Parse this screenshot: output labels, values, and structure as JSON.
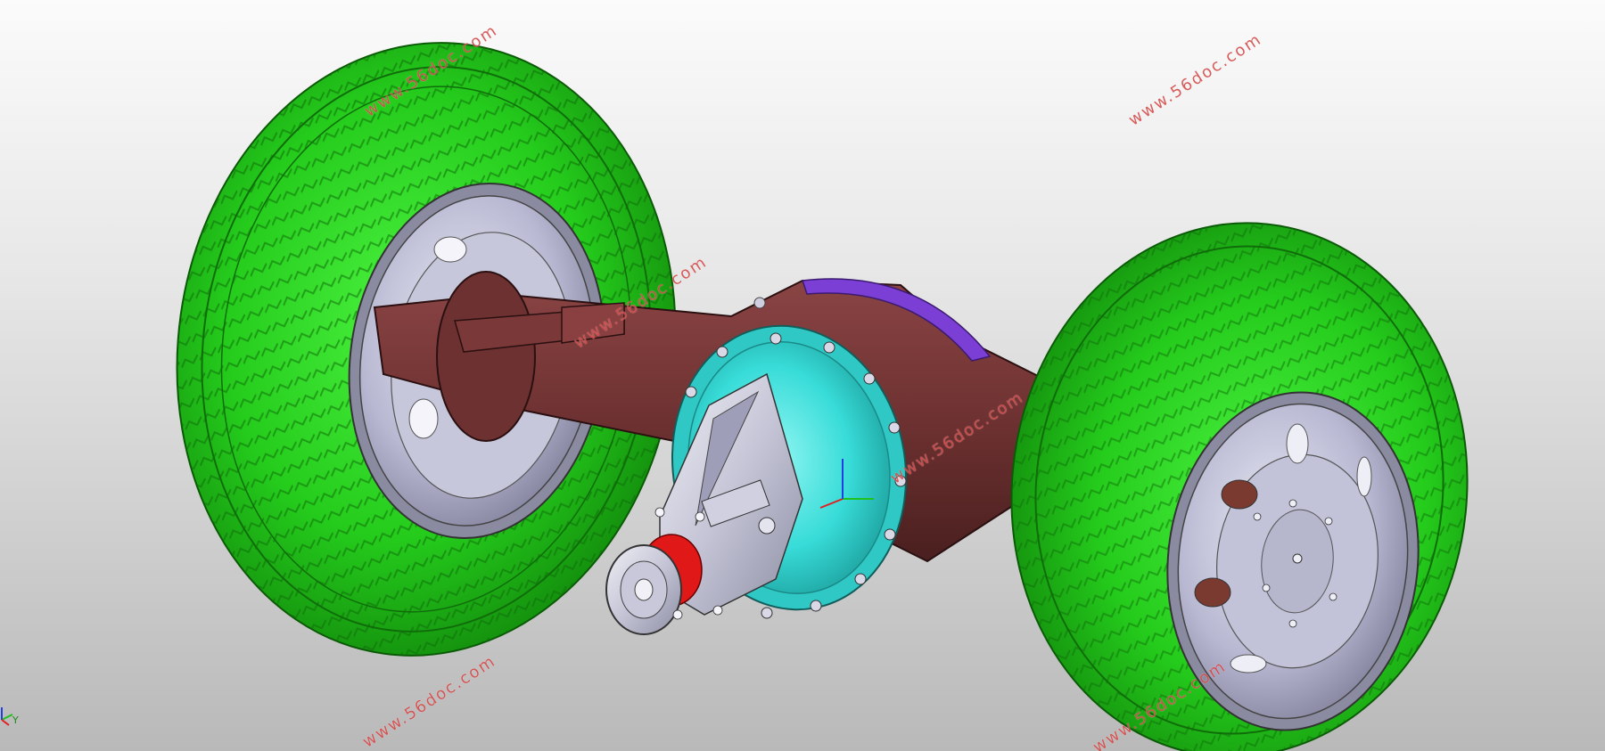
{
  "viewport": {
    "background_top": "#fbfbfb",
    "background_bottom": "#b9b9b9"
  },
  "model": {
    "tire_color": "#27d31f",
    "tire_dark": "#1a9b12",
    "housing_color": "#6e3131",
    "differential_cover_color": "#35e0dc",
    "cover_purple": "#7b3fd6",
    "rim_color": "#b9b9d6",
    "seal_color": "#e01818"
  },
  "watermarks": {
    "w1": "www.56doc.com",
    "w2": "www.56doc.com",
    "w3": "www.56doc.com",
    "w4": "www.56doc.com",
    "w5": "www.56doc.com",
    "w6": "www.56doc.com"
  },
  "triad": {
    "axis_label": "Y"
  }
}
